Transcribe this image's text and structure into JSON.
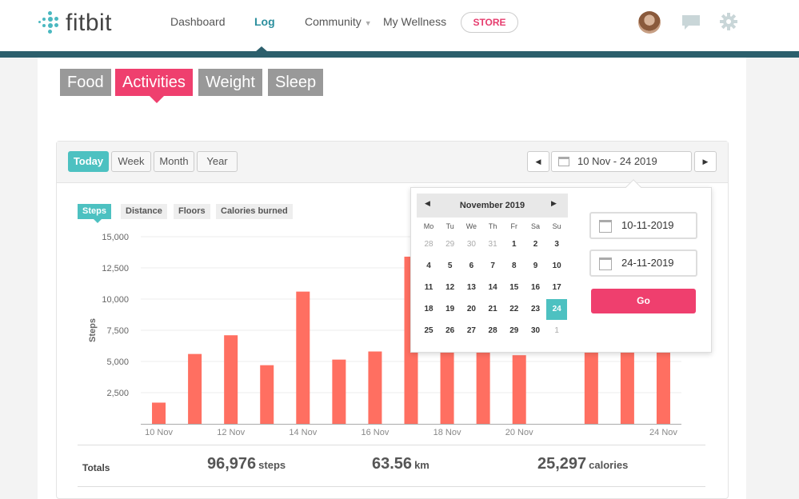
{
  "header": {
    "logo": "fitbit",
    "nav": [
      "Dashboard",
      "Log",
      "Community",
      "My Wellness"
    ],
    "active_nav": "Log",
    "store_label": "STORE"
  },
  "category_tabs": [
    "Food",
    "Activities",
    "Weight",
    "Sleep"
  ],
  "active_category": "Activities",
  "range_buttons": [
    "Today",
    "Week",
    "Month",
    "Year"
  ],
  "active_range": "Today",
  "date_range_label": "10 Nov - 24 2019",
  "metric_tabs": [
    "Steps",
    "Distance",
    "Floors",
    "Calories burned"
  ],
  "active_metric": "Steps",
  "chart_data": {
    "type": "bar",
    "ylabel": "Steps",
    "ylim": [
      0,
      15000
    ],
    "y_ticks": [
      "15,000",
      "12,500",
      "10,000",
      "7,500",
      "5,000",
      "2,500"
    ],
    "x_tick_labels": [
      "10 Nov",
      "12 Nov",
      "14 Nov",
      "16 Nov",
      "18 Nov",
      "20 Nov",
      "24 Nov"
    ],
    "bar_color": "#ff6f61",
    "categories": [
      "10 Nov",
      "11 Nov",
      "12 Nov",
      "13 Nov",
      "14 Nov",
      "15 Nov",
      "16 Nov",
      "17 Nov",
      "18 Nov",
      "19 Nov",
      "20 Nov",
      "21 Nov",
      "22 Nov",
      "23 Nov",
      "24 Nov"
    ],
    "values": [
      1700,
      5600,
      7100,
      4700,
      10600,
      5150,
      5800,
      13400,
      7000,
      6200,
      5500,
      0,
      6500,
      7000,
      6600
    ]
  },
  "totals": {
    "label": "Totals",
    "steps_value": "96,976",
    "steps_unit": "steps",
    "distance_value": "63.56",
    "distance_unit": "km",
    "calories_value": "25,297",
    "calories_unit": "calories"
  },
  "calendar": {
    "month_label": "November 2019",
    "weekdays": [
      "Mo",
      "Tu",
      "We",
      "Th",
      "Fr",
      "Sa",
      "Su"
    ],
    "weeks": [
      [
        "28",
        "29",
        "30",
        "31",
        "1",
        "2",
        "3"
      ],
      [
        "4",
        "5",
        "6",
        "7",
        "8",
        "9",
        "10"
      ],
      [
        "11",
        "12",
        "13",
        "14",
        "15",
        "16",
        "17"
      ],
      [
        "18",
        "19",
        "20",
        "21",
        "22",
        "23",
        "24"
      ],
      [
        "25",
        "26",
        "27",
        "28",
        "29",
        "30",
        "1"
      ]
    ],
    "selected_day": "24",
    "start_date": "10-11-2019",
    "end_date": "24-11-2019",
    "go_label": "Go"
  },
  "colors": {
    "brand_teal": "#4dc1c1",
    "accent_pink": "#ef3f6e",
    "bar": "#ff6f61",
    "header_bar": "#2c5f6c"
  }
}
